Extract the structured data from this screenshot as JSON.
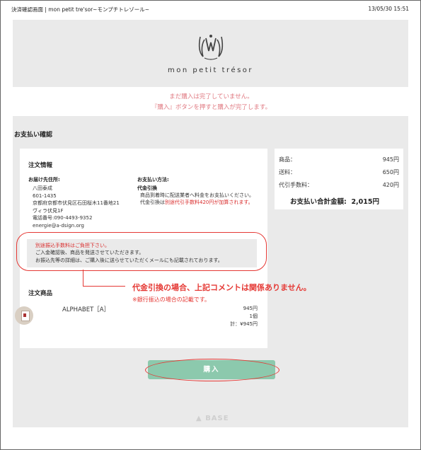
{
  "window": {
    "title": "決済確認画面 | mon petit tre'sor~モンプチトレゾール~",
    "datetime": "13/05/30 15:51"
  },
  "brand": {
    "name": "mon petit trésor",
    "logo": "crown-monogram-logo"
  },
  "notice": {
    "line1": "まだ購入は完了していません。",
    "line2": "『購入』ボタンを押すと購入が完了します。"
  },
  "section_title": "お支払い確認",
  "order": {
    "heading": "注文情報",
    "delivery_label": "お届け先住所:",
    "delivery_lines": [
      "八田泰成",
      "601-1435",
      "京都府京都市伏見区石田桜木11番地21",
      "ヴィラ伏見1F",
      "電話番号:090-4493-9352",
      "energie@a-dsign.org"
    ],
    "payment_label": "お支払い方法:",
    "payment_method": "代金引換",
    "payment_note1": "商品到着時に配送業者へ料金をお支払いください。",
    "payment_note2_prefix": "代金引換は",
    "payment_note2_red": "別途代引手数料420円が加算されます。",
    "transfer_box": {
      "line1": "別途振込手数料はご負担下さい。",
      "line2": "ご入金確認後、商品を発送させていただきます。",
      "line3": "お振込先等の詳細は、ご購入後に送らせていただくメールにも記載されております。"
    },
    "items_heading": "注文商品",
    "item": {
      "name": "ALPHABET［A］",
      "price": "945円",
      "qty": "1個",
      "total": "計：¥945円"
    }
  },
  "summary": {
    "rows": [
      {
        "label": "商品：",
        "value": "945円"
      },
      {
        "label": "送料：",
        "value": "650円"
      },
      {
        "label": "代引手数料：",
        "value": "420円"
      }
    ],
    "total_label": "お支払い合計金額:",
    "total_value": "2,015円"
  },
  "annotation": {
    "main": "代金引換の場合、上記コメントは関係ありません。",
    "sub": "※銀行振込の場合の記載です。"
  },
  "buy_button": "購入",
  "footer": "BASE"
}
